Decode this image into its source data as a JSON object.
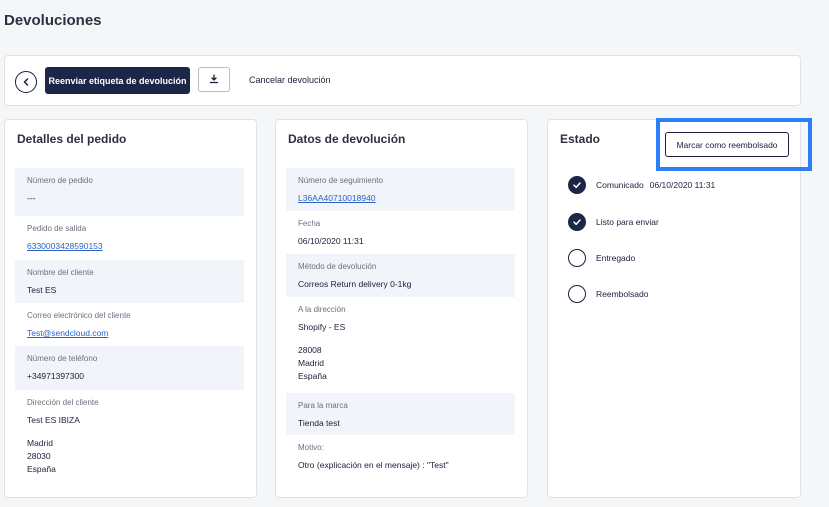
{
  "page": {
    "title": "Devoluciones"
  },
  "toolbar": {
    "resend_label": "Reenviar etiqueta de devolución",
    "cancel_label": "Cancelar devolución"
  },
  "order_details": {
    "title": "Detalles del pedido",
    "fields": [
      {
        "label": "Número de pedido",
        "value": "---"
      },
      {
        "label": "Pedido de salida",
        "value": "6330003428590153"
      },
      {
        "label": "Nombre del cliente",
        "value": "Test ES"
      },
      {
        "label": "Correo electrónico del cliente",
        "value": "Test@sendcloud.com"
      },
      {
        "label": "Número de teléfono",
        "value": "+34971397300"
      },
      {
        "label": "Dirección del cliente",
        "lines": [
          "Test ES IBIZA",
          "",
          "Madrid",
          "28030",
          "España"
        ]
      }
    ]
  },
  "return_data": {
    "title": "Datos de devolución",
    "fields": [
      {
        "label": "Número de seguimiento",
        "value": "L36AA40710018940"
      },
      {
        "label": "Fecha",
        "value": "06/10/2020 11:31"
      },
      {
        "label": "Método de devolución",
        "value": "Correos Return delivery 0-1kg"
      },
      {
        "label": "A la dirección",
        "lines": [
          "Shopify - ES",
          "",
          "28008",
          "Madrid",
          "España"
        ]
      },
      {
        "label": "Para la marca",
        "value": "Tienda test"
      },
      {
        "label": "Motivo:",
        "value": "Otro (explicación en el mensaje) : \"Test\""
      }
    ]
  },
  "status": {
    "title": "Estado",
    "mark_refunded_label": "Marcar como reembolsado",
    "steps": [
      {
        "label": "Comunicado",
        "date": "06/10/2020 11:31",
        "done": true
      },
      {
        "label": "Listo para enviar",
        "date": "",
        "done": true
      },
      {
        "label": "Entregado",
        "date": "",
        "done": false
      },
      {
        "label": "Reembolsado",
        "date": "",
        "done": false
      }
    ]
  },
  "colors": {
    "primary": "#1c2748",
    "link": "#2b63c7",
    "highlight": "#2d7ff9",
    "background": "#f5f6f8"
  }
}
